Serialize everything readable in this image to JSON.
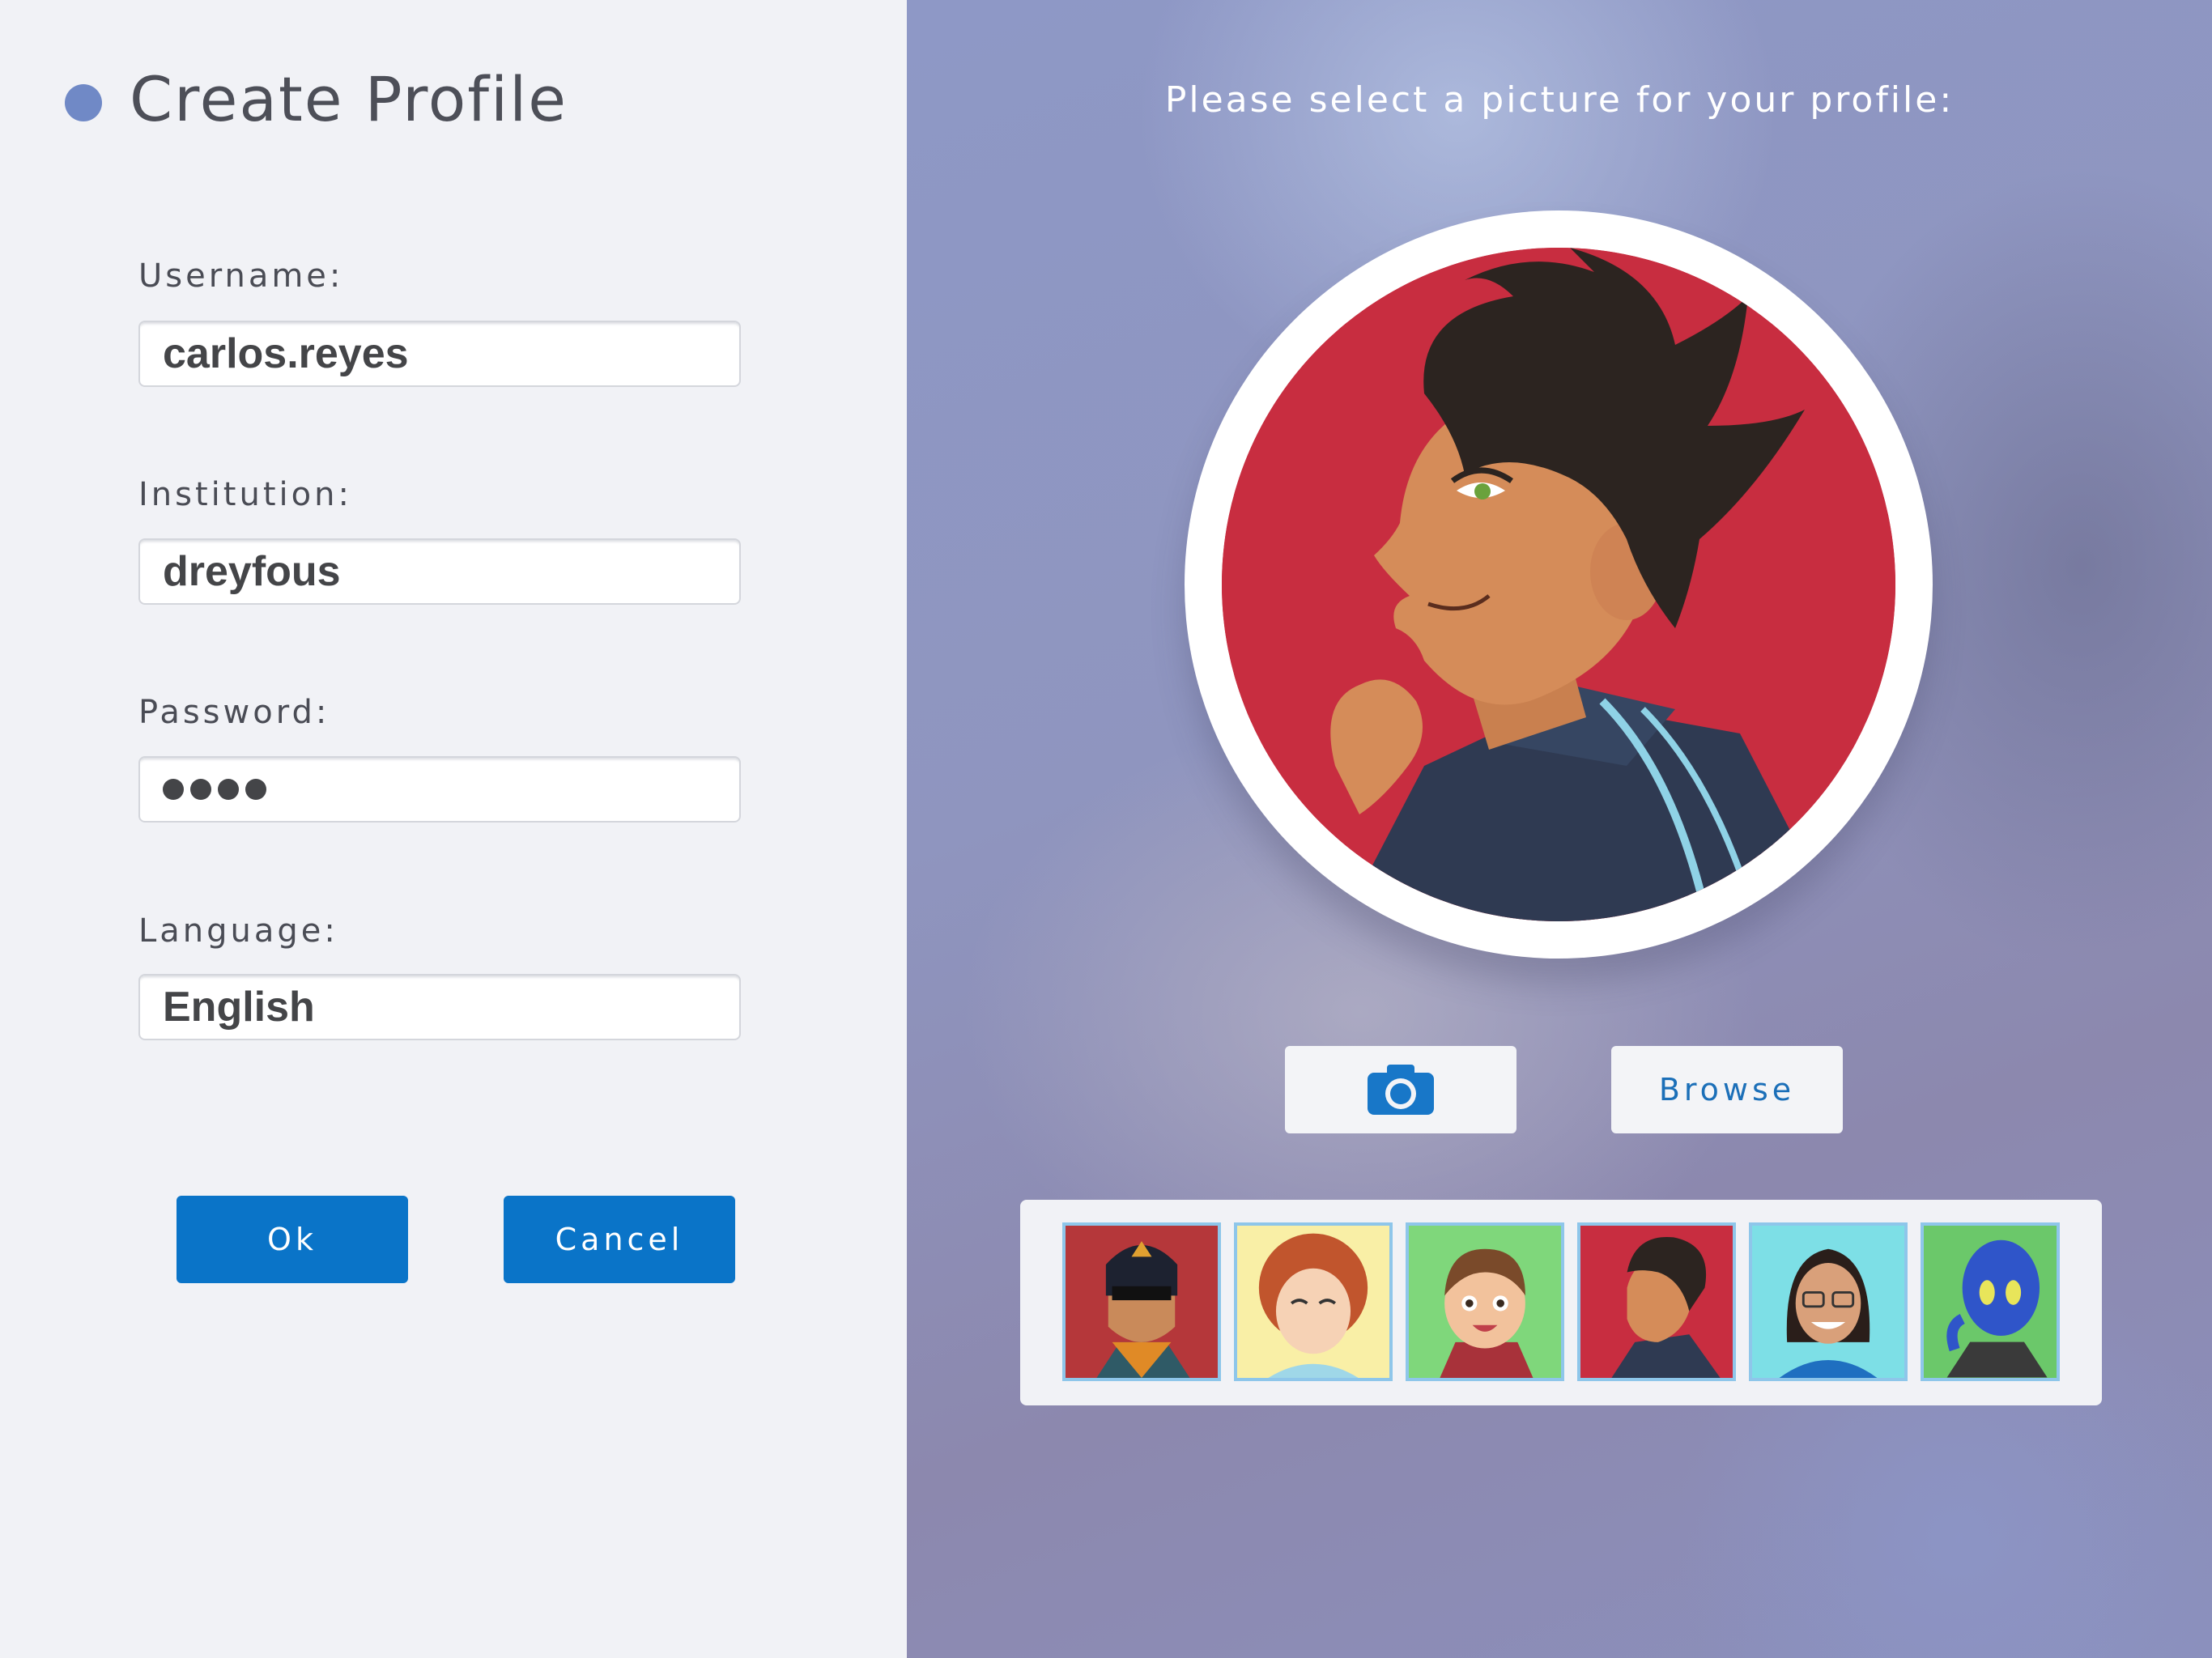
{
  "form": {
    "title": "Create Profile",
    "fields": [
      {
        "label": "Username:",
        "value": "carlos.reyes"
      },
      {
        "label": "Institution:",
        "value": "dreyfous"
      },
      {
        "label": "Password:",
        "value": "",
        "masked_length": 4
      },
      {
        "label": "Language:",
        "value": "English"
      }
    ],
    "ok_label": "Ok",
    "cancel_label": "Cancel"
  },
  "picture": {
    "prompt": "Please select a picture for your profile:",
    "camera_icon": "camera-icon",
    "browse_label": "Browse",
    "selected_avatar": "boy-dark-hair-avatar",
    "thumbnails": [
      {
        "name": "masked-hero-avatar",
        "bg": "#b5373a"
      },
      {
        "name": "curly-hair-girl-avatar",
        "bg": "#f9efa6"
      },
      {
        "name": "ponytail-girl-avatar",
        "bg": "#7fd77b"
      },
      {
        "name": "boy-dark-hair-avatar",
        "bg": "#c82d40"
      },
      {
        "name": "glasses-woman-avatar",
        "bg": "#7ddfe6"
      },
      {
        "name": "blue-alien-avatar",
        "bg": "#6bc86a"
      }
    ]
  },
  "colors": {
    "accent": "#0a74c8",
    "title_dot": "#7089c6",
    "thumb_border": "#8ec6ea"
  }
}
